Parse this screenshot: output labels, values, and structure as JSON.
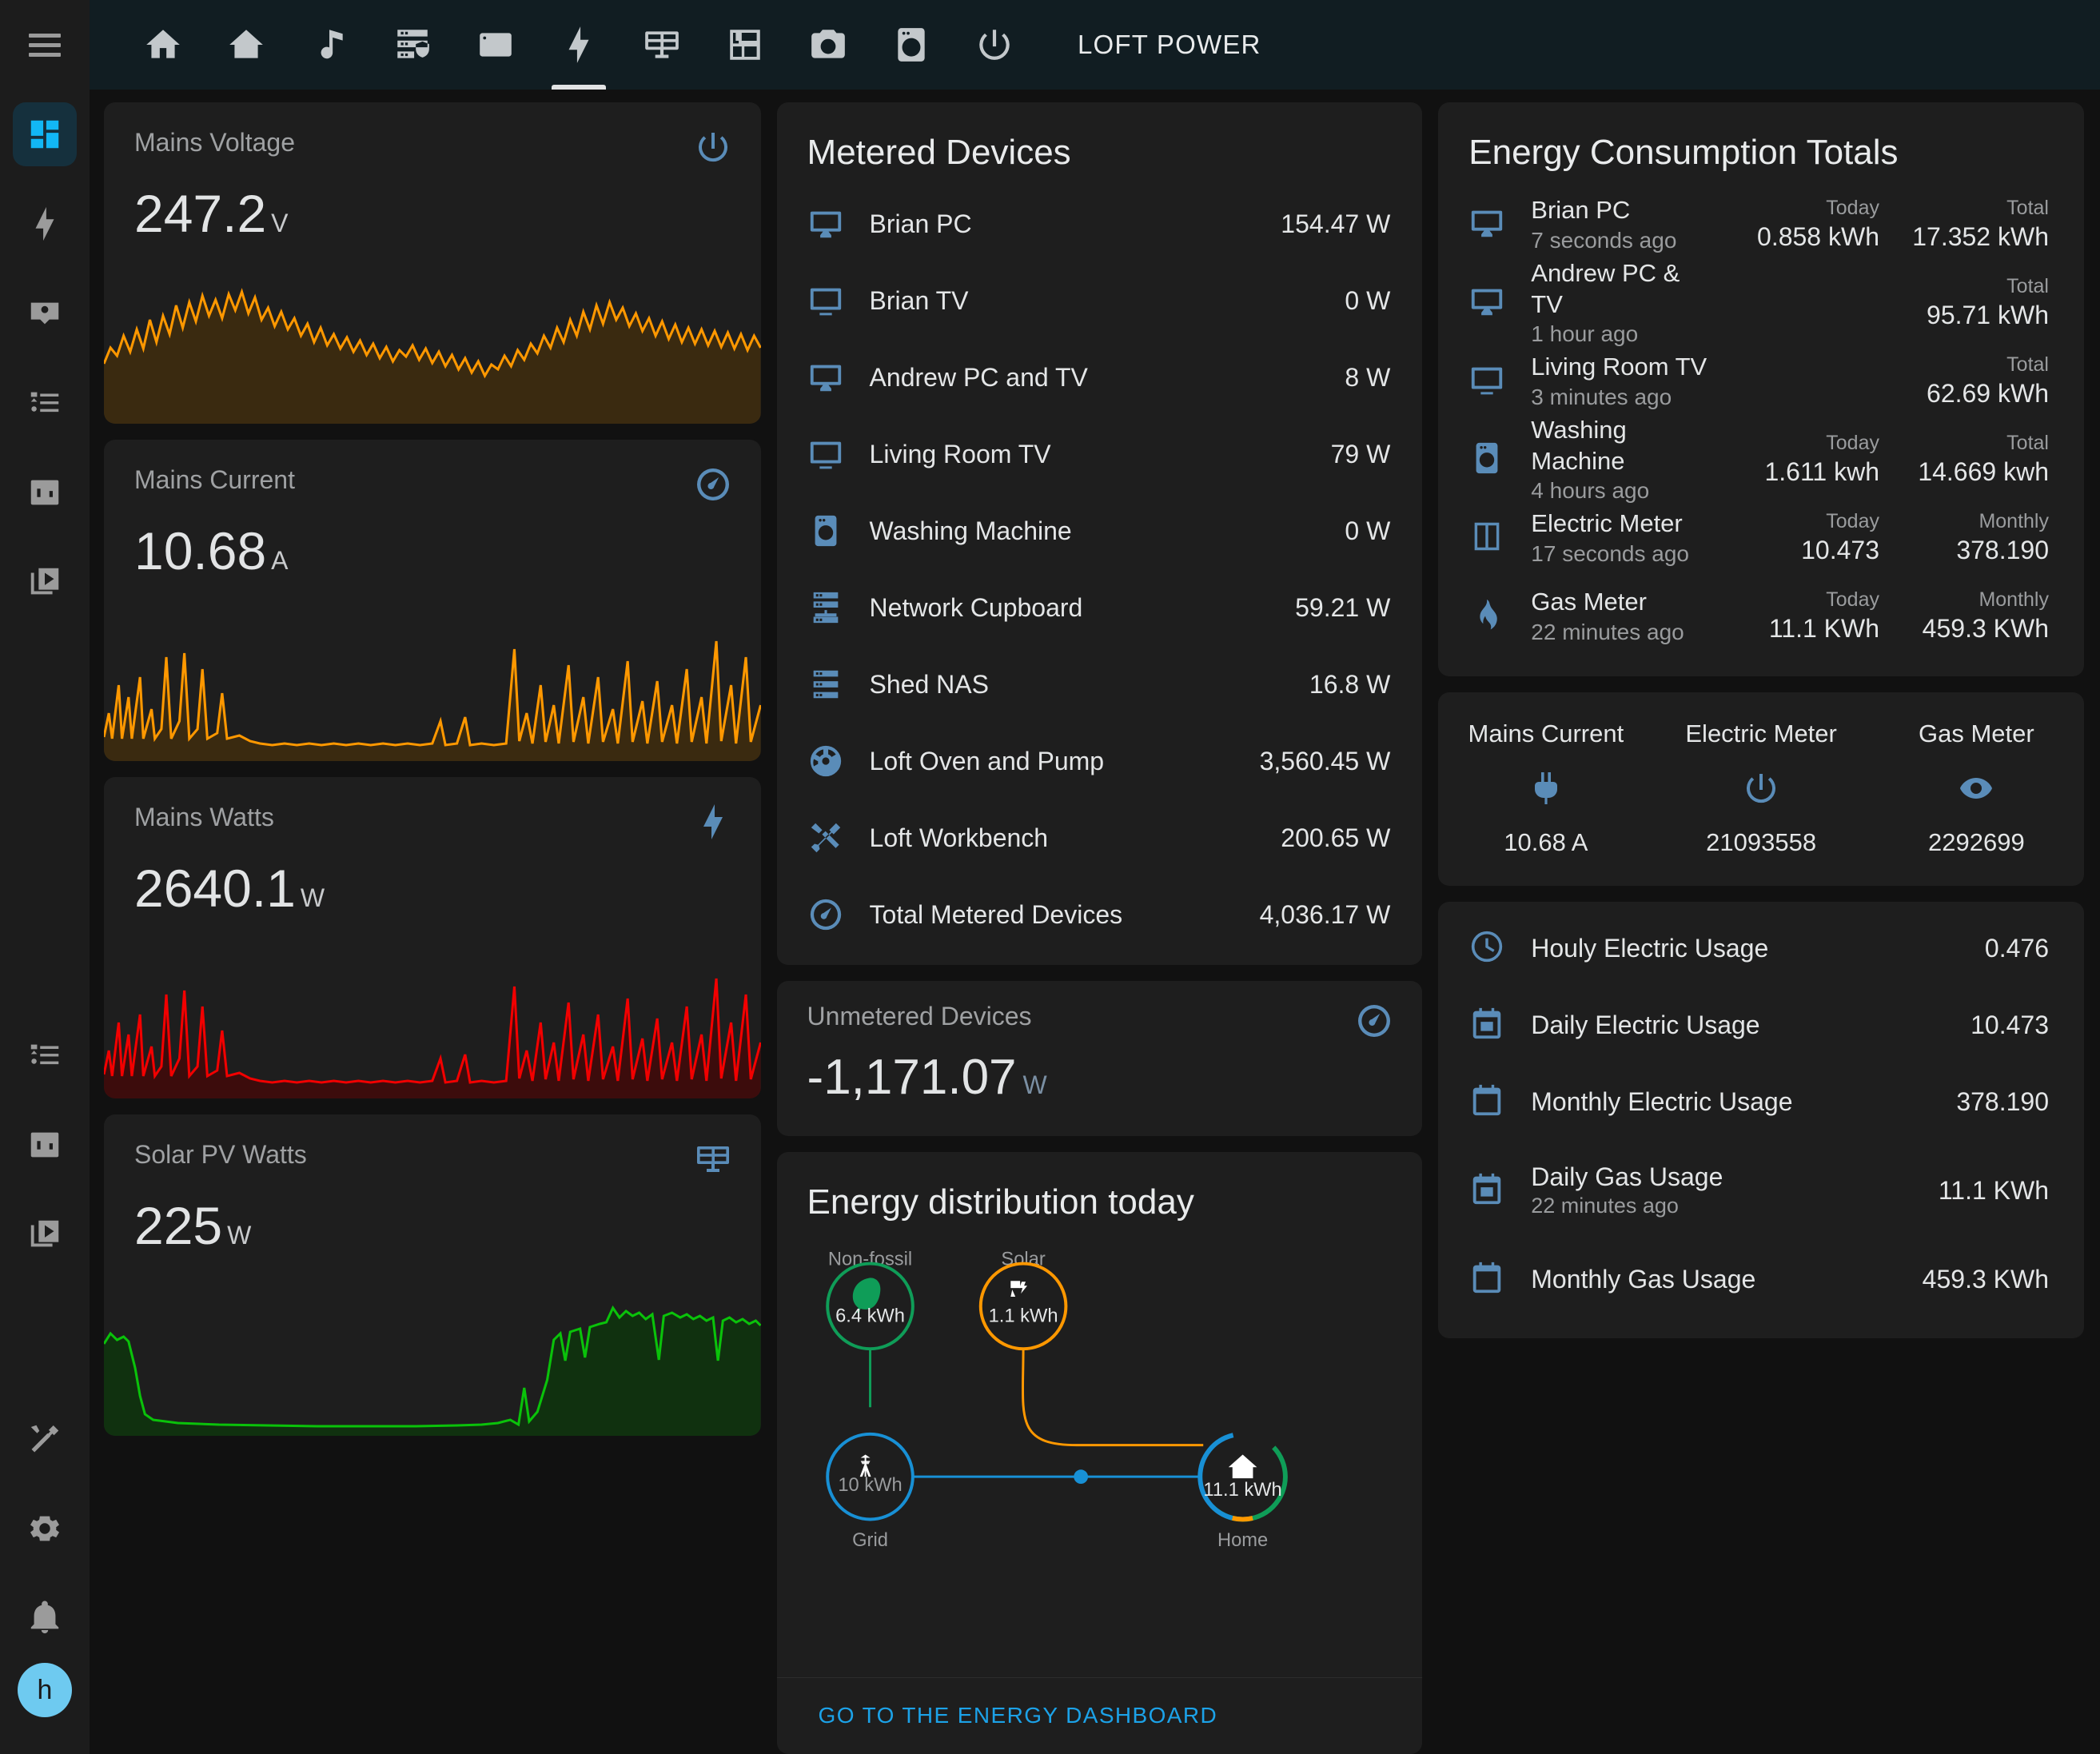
{
  "topbar": {
    "title": "LOFT POWER",
    "tabs": [
      {
        "icon": "home-icon",
        "name": "tab-home",
        "active": false
      },
      {
        "icon": "home-thermometer-icon",
        "name": "tab-climate",
        "active": false
      },
      {
        "icon": "music-note-icon",
        "name": "tab-media",
        "active": false
      },
      {
        "icon": "server-security-icon",
        "name": "tab-network",
        "active": false
      },
      {
        "icon": "nas-icon",
        "name": "tab-nas",
        "active": false
      },
      {
        "icon": "lightning-bolt-icon",
        "name": "tab-power",
        "active": true
      },
      {
        "icon": "solar-panel-icon",
        "name": "tab-solar",
        "active": false
      },
      {
        "icon": "floor-plan-icon",
        "name": "tab-floorplan",
        "active": false
      },
      {
        "icon": "camera-icon",
        "name": "tab-cameras",
        "active": false
      },
      {
        "icon": "washing-machine-icon",
        "name": "tab-appliances",
        "active": false
      },
      {
        "icon": "power-icon",
        "name": "tab-switches",
        "active": false
      }
    ]
  },
  "sidebar": {
    "menu_icon": "hamburger-menu-icon",
    "avatar_initial": "h",
    "items": [
      {
        "icon": "view-dashboard-icon",
        "name": "sidebar-item-overview",
        "active": true
      },
      {
        "icon": "lightning-bolt-icon",
        "name": "sidebar-item-energy",
        "active": false
      },
      {
        "icon": "account-box-icon",
        "name": "sidebar-item-contacts",
        "active": false
      },
      {
        "icon": "format-list-icon",
        "name": "sidebar-item-logbook",
        "active": false
      },
      {
        "icon": "chart-box-icon",
        "name": "sidebar-item-history",
        "active": false
      },
      {
        "icon": "media-play-icon",
        "name": "sidebar-item-media",
        "active": false
      },
      {
        "icon": "format-list-icon",
        "name": "sidebar-item-logbook-2",
        "active": false
      },
      {
        "icon": "chart-box-icon",
        "name": "sidebar-item-history-2",
        "active": false
      },
      {
        "icon": "media-play-icon",
        "name": "sidebar-item-media-2",
        "active": false
      },
      {
        "icon": "hammer-wrench-icon",
        "name": "sidebar-item-developer-tools",
        "active": false
      },
      {
        "icon": "cog-icon",
        "name": "sidebar-item-settings",
        "active": false
      },
      {
        "icon": "bell-icon",
        "name": "sidebar-item-notifications",
        "active": false
      }
    ]
  },
  "sensors": [
    {
      "name": "Mains Voltage",
      "value": "247.2",
      "unit": "V",
      "icon": "power-icon",
      "color": "#ff9800"
    },
    {
      "name": "Mains Current",
      "value": "10.68",
      "unit": "A",
      "icon": "gauge-icon",
      "color": "#ff9800"
    },
    {
      "name": "Mains Watts",
      "value": "2640.1",
      "unit": "W",
      "icon": "flash-icon",
      "color": "#f20000"
    },
    {
      "name": "Solar PV Watts",
      "value": "225",
      "unit": "W",
      "icon": "solar-panel-icon",
      "color": "#0ac20a"
    }
  ],
  "metered": {
    "title": "Metered Devices",
    "rows": [
      {
        "icon": "monitor-icon",
        "name": "Brian PC",
        "value": "154.47 W"
      },
      {
        "icon": "television-icon",
        "name": "Brian TV",
        "value": "0 W"
      },
      {
        "icon": "monitor-icon",
        "name": "Andrew PC and TV",
        "value": "8 W"
      },
      {
        "icon": "television-icon",
        "name": "Living Room TV",
        "value": "79 W"
      },
      {
        "icon": "washing-machine-icon",
        "name": "Washing Machine",
        "value": "0 W"
      },
      {
        "icon": "server-network-icon",
        "name": "Network Cupboard",
        "value": "59.21 W"
      },
      {
        "icon": "server-icon",
        "name": "Shed NAS",
        "value": "16.8 W"
      },
      {
        "icon": "oven-pump-icon",
        "name": "Loft Oven and Pump",
        "value": "3,560.45 W"
      },
      {
        "icon": "tools-icon",
        "name": "Loft Workbench",
        "value": "200.65 W"
      },
      {
        "icon": "gauge-icon",
        "name": "Total Metered Devices",
        "value": "4,036.17 W"
      }
    ]
  },
  "unmetered": {
    "name": "Unmetered Devices",
    "value": "-1,171.07",
    "unit": "W",
    "icon": "gauge-icon"
  },
  "energy_distribution": {
    "title": "Energy distribution today",
    "link_label": "GO TO THE ENERGY DASHBOARD",
    "nodes": {
      "non_fossil": {
        "label": "Non-fossil",
        "value": "6.4 kWh",
        "color": "#0f9d58",
        "icon": "leaf-icon"
      },
      "solar": {
        "label": "Solar",
        "value": "1.1 kWh",
        "color": "#ff9800",
        "icon": "solar-power-icon"
      },
      "grid": {
        "label": "Grid",
        "value": "10 kWh",
        "color": "#1890d5",
        "icon": "transmission-tower-icon"
      },
      "home": {
        "label": "Home",
        "value": "11.1 kWh",
        "color": "#0f9d58",
        "icon": "home-icon"
      }
    }
  },
  "totals": {
    "title": "Energy Consumption Totals",
    "rows": [
      {
        "icon": "monitor-icon",
        "name": "Brian PC",
        "sub": "7 seconds ago",
        "cols": [
          {
            "label": "Today",
            "value": "0.858 kWh"
          },
          {
            "label": "Total",
            "value": "17.352 kWh"
          }
        ]
      },
      {
        "icon": "monitor-icon",
        "name": "Andrew PC & TV",
        "sub": "1 hour ago",
        "cols": [
          {
            "label": "",
            "value": ""
          },
          {
            "label": "Total",
            "value": "95.71 kWh"
          }
        ]
      },
      {
        "icon": "television-icon",
        "name": "Living Room TV",
        "sub": "3 minutes ago",
        "cols": [
          {
            "label": "",
            "value": ""
          },
          {
            "label": "Total",
            "value": "62.69 kWh"
          }
        ]
      },
      {
        "icon": "washing-machine-icon",
        "name": "Washing Machine",
        "sub": "4 hours ago",
        "cols": [
          {
            "label": "Today",
            "value": "1.611 kwh"
          },
          {
            "label": "Total",
            "value": "14.669 kwh"
          }
        ]
      },
      {
        "icon": "meter-electric-icon",
        "name": "Electric Meter",
        "sub": "17 seconds ago",
        "cols": [
          {
            "label": "Today",
            "value": "10.473"
          },
          {
            "label": "Monthly",
            "value": "378.190"
          }
        ]
      },
      {
        "icon": "fire-icon",
        "name": "Gas Meter",
        "sub": "22 minutes ago",
        "cols": [
          {
            "label": "Today",
            "value": "11.1 KWh"
          },
          {
            "label": "Monthly",
            "value": "459.3 KWh"
          }
        ]
      }
    ]
  },
  "glance": {
    "cells": [
      {
        "name": "Mains Current",
        "icon": "power-plug-icon",
        "value": "10.68 A"
      },
      {
        "name": "Electric Meter",
        "icon": "power-icon",
        "value": "21093558"
      },
      {
        "name": "Gas Meter",
        "icon": "eye-icon",
        "value": "2292699"
      }
    ]
  },
  "usage": {
    "rows": [
      {
        "icon": "clock-icon",
        "name": "Houly Electric Usage",
        "sub": "",
        "value": "0.476"
      },
      {
        "icon": "calendar-today-icon",
        "name": "Daily Electric Usage",
        "sub": "",
        "value": "10.473"
      },
      {
        "icon": "calendar-icon",
        "name": "Monthly Electric Usage",
        "sub": "",
        "value": "378.190"
      },
      {
        "icon": "calendar-today-icon",
        "name": "Daily Gas Usage",
        "sub": "22 minutes ago",
        "value": "11.1 KWh"
      },
      {
        "icon": "calendar-icon",
        "name": "Monthly Gas Usage",
        "sub": "",
        "value": "459.3 KWh"
      }
    ]
  },
  "theme": {
    "accent": "#12b7f5",
    "card_bg": "#1e1e1e",
    "page_bg": "#111111",
    "icon_blue": "#5a8cb8",
    "link_blue": "#1ca2e8"
  }
}
